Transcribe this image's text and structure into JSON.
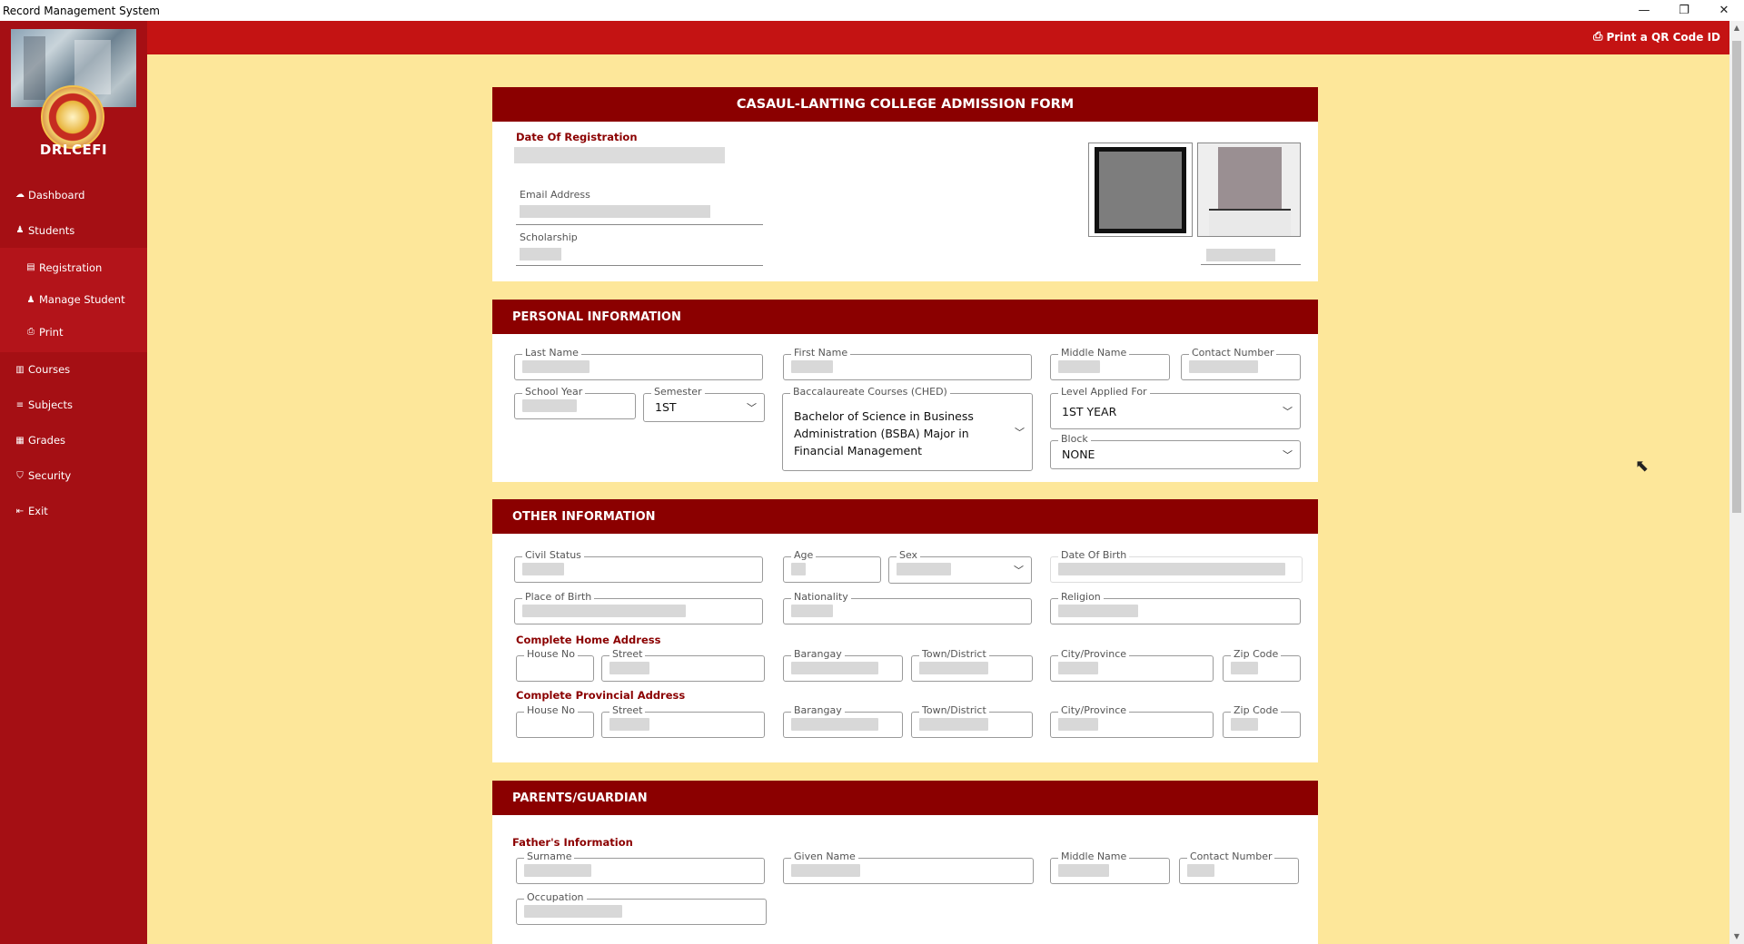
{
  "window": {
    "title": "Record Management System",
    "minimize": "—",
    "restore": "❐",
    "close": "✕"
  },
  "sidebar": {
    "brand": "DRLCEFI",
    "items": [
      {
        "label": "Dashboard",
        "icon": "dashboard-icon"
      },
      {
        "label": "Students",
        "icon": "user-icon"
      },
      {
        "label": "Courses",
        "icon": "book-icon"
      },
      {
        "label": "Subjects",
        "icon": "list-icon"
      },
      {
        "label": "Grades",
        "icon": "grades-icon"
      },
      {
        "label": "Security",
        "icon": "shield-icon"
      },
      {
        "label": "Exit",
        "icon": "exit-icon"
      }
    ],
    "sub_items": [
      {
        "label": "Registration",
        "icon": "form-icon"
      },
      {
        "label": "Manage Student",
        "icon": "user-edit-icon"
      },
      {
        "label": "Print",
        "icon": "print-icon"
      }
    ]
  },
  "topbar": {
    "print_qr_label": "Print a QR Code ID"
  },
  "form": {
    "title": "CASAUL-LANTING COLLEGE ADMISSION FORM",
    "registration": {
      "date_label": "Date Of Registration",
      "email_label": "Email Address",
      "scholarship_label": "Scholarship"
    },
    "personal": {
      "heading": "PERSONAL INFORMATION",
      "last_name": "Last Name",
      "first_name": "First Name",
      "middle_name": "Middle Name",
      "contact_number": "Contact Number",
      "school_year": "School Year",
      "semester_label": "Semester",
      "semester_value": "1ST",
      "course_label": "Baccalaureate Courses (CHED)",
      "course_value_1": "Bachelor of Science in Business",
      "course_value_2": "Administration (BSBA) Major in",
      "course_value_3": "Financial Management",
      "level_label": "Level Applied For",
      "level_value": "1ST YEAR",
      "block_label": "Block",
      "block_value": "NONE"
    },
    "other": {
      "heading": "OTHER INFORMATION",
      "civil_status": "Civil Status",
      "age": "Age",
      "sex": "Sex",
      "date_of_birth": "Date Of Birth",
      "place_of_birth": "Place of Birth",
      "nationality": "Nationality",
      "religion": "Religion",
      "home_address_label": "Complete Home Address",
      "provincial_address_label": "Complete Provincial Address",
      "house_no": "House No",
      "street": "Street",
      "barangay": "Barangay",
      "town": "Town/District",
      "city": "City/Province",
      "zip": "Zip Code"
    },
    "parents": {
      "heading": "PARENTS/GUARDIAN",
      "father_label": "Father's Information",
      "surname": "Surname",
      "given_name": "Given Name",
      "middle_name": "Middle Name",
      "contact_number": "Contact Number",
      "occupation": "Occupation"
    }
  }
}
